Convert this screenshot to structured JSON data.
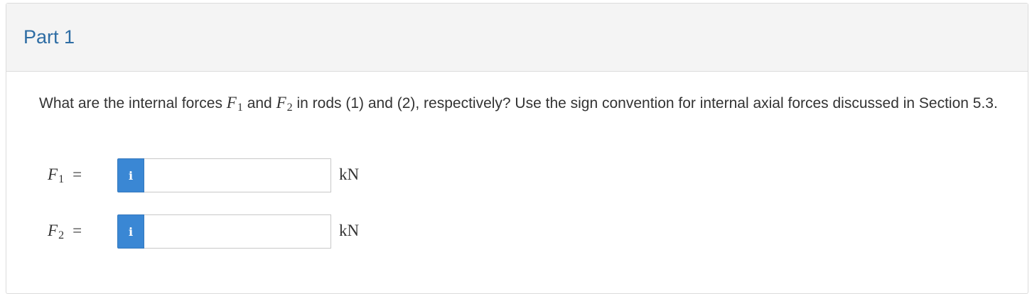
{
  "part": {
    "title": "Part 1"
  },
  "question": {
    "text_1": "What are the internal forces ",
    "var_1": "F",
    "var_1_sub": "1",
    "text_2": " and ",
    "var_2": "F",
    "var_2_sub": "2",
    "text_3": " in rods (1) and (2), respectively? Use the sign convention for internal axial forces discussed in Section 5.3."
  },
  "answers": [
    {
      "symbol": "F",
      "subscript": "1",
      "equals": "=",
      "info_icon": "info-icon",
      "info_glyph": "i",
      "value": "",
      "placeholder": "",
      "unit": "kN"
    },
    {
      "symbol": "F",
      "subscript": "2",
      "equals": "=",
      "info_icon": "info-icon",
      "info_glyph": "i",
      "value": "",
      "placeholder": "",
      "unit": "kN"
    }
  ],
  "colors": {
    "title": "#2e6da4",
    "header_bg": "#f4f4f4",
    "info_button": "#3a87d4",
    "text": "#333333"
  }
}
